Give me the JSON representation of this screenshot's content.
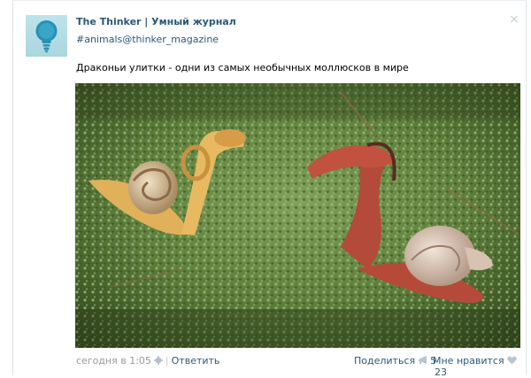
{
  "post": {
    "author": "The Thinker | Умный журнал",
    "hashtag": "#animals@thinker_magazine",
    "text": "Драконьи улитки - одни из самых необычных моллюсков в мире",
    "close_icon": "×"
  },
  "footer": {
    "time": "сегодня в 1:05",
    "reply": "Ответить",
    "share": "Поделиться",
    "share_count": "5",
    "like": "Мне нравится",
    "like_count": "23"
  },
  "colors": {
    "link": "#2b587a",
    "muted": "#999999",
    "avatar_bg": "#bfe3ea"
  },
  "icons": [
    "lightbulb-logo",
    "close-icon",
    "gear-icon",
    "megaphone-icon",
    "heart-icon"
  ]
}
